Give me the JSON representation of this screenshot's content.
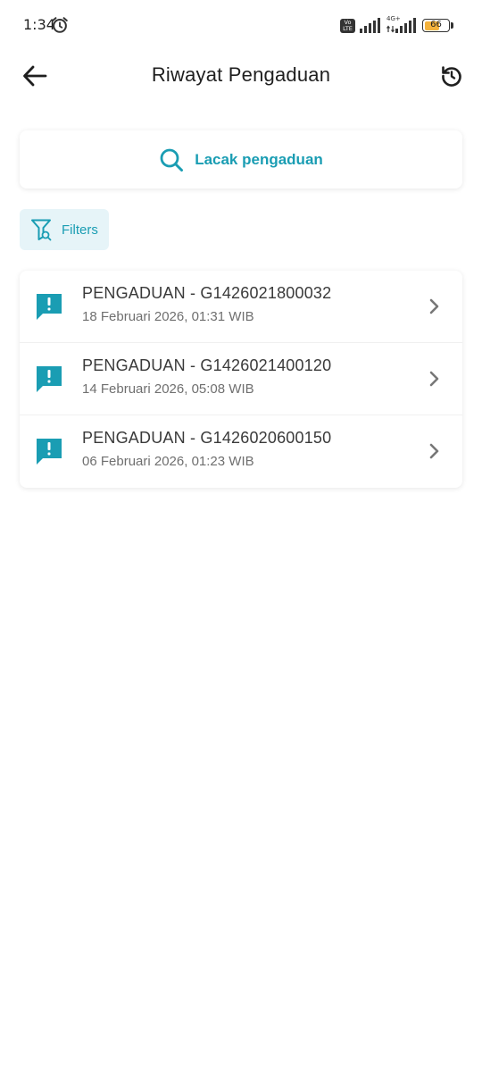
{
  "status_bar": {
    "time": "1:34",
    "volte": "Vo\nLTE",
    "network_type": "4G+",
    "battery_level": "66",
    "battery_fraction": 0.66
  },
  "header": {
    "title": "Riwayat Pengaduan",
    "back_icon": "arrow-left-icon",
    "refresh_icon": "refresh-icon"
  },
  "search": {
    "label": "Lacak pengaduan",
    "icon": "search-icon"
  },
  "filters": {
    "label": "Filters",
    "icon": "filter-icon"
  },
  "complaints": [
    {
      "title": "PENGADUAN - G1426021800032",
      "date": "18 Februari 2026, 01:31 WIB"
    },
    {
      "title": "PENGADUAN - G1426021400120",
      "date": "14 Februari 2026, 05:08 WIB"
    },
    {
      "title": "PENGADUAN - G1426020600150",
      "date": "06 Februari 2026, 01:23 WIB"
    }
  ],
  "colors": {
    "accent": "#1a9db3",
    "filter_bg": "#e6f4f8",
    "battery": "#f4b23c"
  }
}
